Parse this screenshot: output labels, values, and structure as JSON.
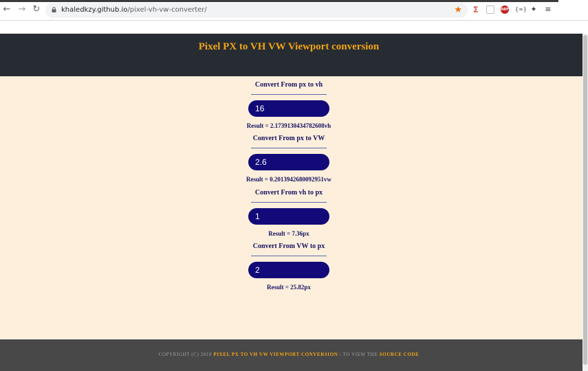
{
  "browser": {
    "url_host": "khaledkzy.github.io",
    "url_path": "/pixel-vh-vw-converter/",
    "ext_3_label": "ABP",
    "ext_4_label": "{∞}"
  },
  "header": {
    "title": "Pixel PX to VH VW Viewport conversion"
  },
  "converters": [
    {
      "label": "Convert From px to vh",
      "value": "16",
      "result": "Result = 2.1739130434782608vh"
    },
    {
      "label": "Convert From px to VW",
      "value": "2.6",
      "result": "Result = 0.2013942680092951vw"
    },
    {
      "label": "Convert From vh to px",
      "value": "1",
      "result": "Result = 7.36px"
    },
    {
      "label": "Convert From VW to px",
      "value": "2",
      "result": "Result = 25.82px"
    }
  ],
  "footer": {
    "prefix": "COPYRIGHT (C) 2018 ",
    "project_link": "PIXEL PX TO VH VW VIEWPORT CONVERSION",
    "separator": " / TO VIEW THE ",
    "source_link": "SOURCE CODE"
  },
  "colors": {
    "header_bg": "#272c33",
    "accent": "#f2a413",
    "page_bg": "#fdefdc",
    "input_bg": "#130a79",
    "text_dark": "#121061",
    "footer_bg": "#484848"
  }
}
